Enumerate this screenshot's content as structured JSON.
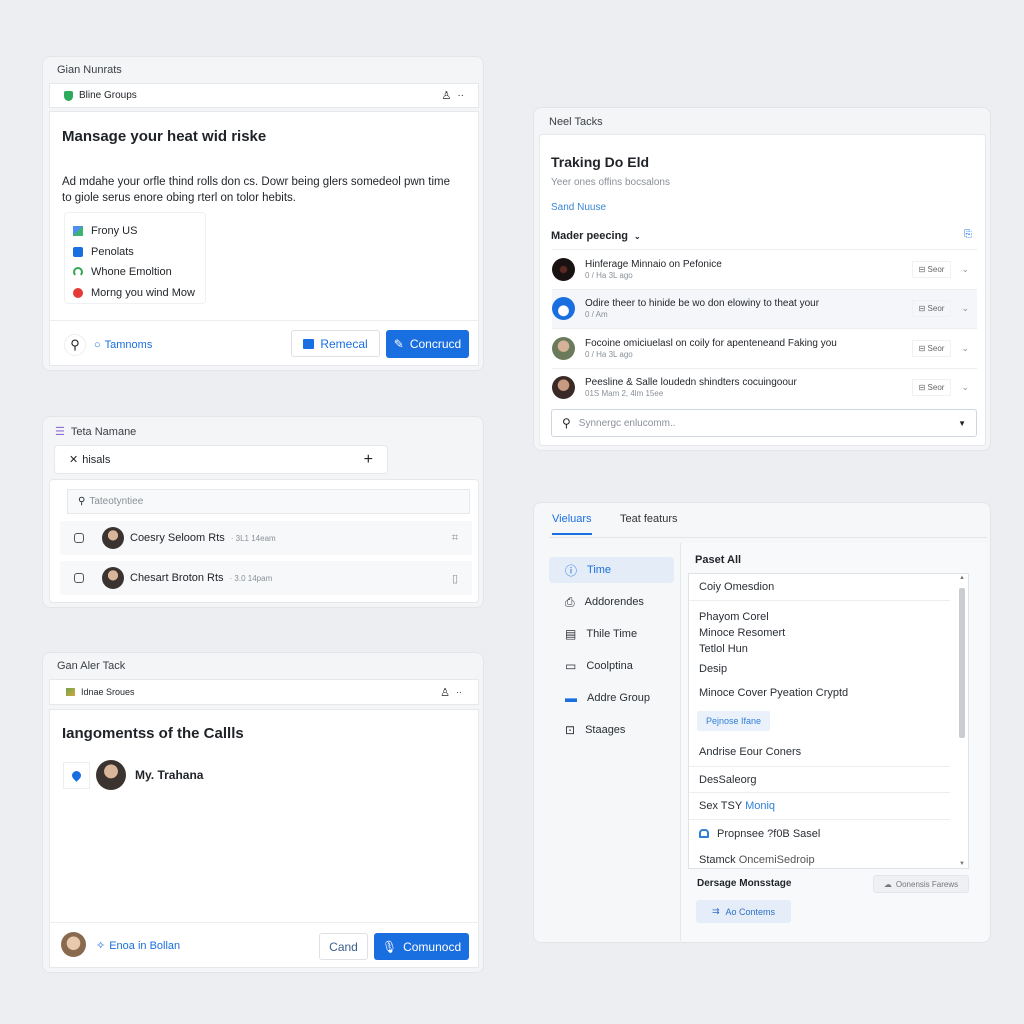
{
  "panel1": {
    "title": "Gian Nunrats",
    "header": "Bline Groups",
    "heading": "Mansage your heat wid riske",
    "body": "Ad mdahe your orfle thind rolls don cs. Dowr being glers somedeol pwn time to giole serus enore obing rterl on tolor hebits.",
    "items": [
      {
        "label": "Frony US",
        "icon": "apps-icon",
        "color": "#3b82f6"
      },
      {
        "label": "Penolats",
        "icon": "document-icon",
        "color": "#1a6fe0"
      },
      {
        "label": "Whone Emoltion",
        "icon": "refresh-icon",
        "color": "#34a853"
      },
      {
        "label": "Morng you wind Mow",
        "icon": "record-icon",
        "color": "#e53935"
      }
    ],
    "link": "Tamnoms",
    "secondary": "Remecal",
    "primary": "Concrucd"
  },
  "panel2": {
    "title": "Neel Tacks",
    "heading": "Traking Do Eld",
    "subtitle": "Yeer ones offins bocsalons",
    "link": "Sand Nuuse",
    "section": "Mader peecing",
    "rows": [
      {
        "title": "Hinferage Minnaio on Pefonice",
        "meta": "0 / Ha 3L ago",
        "action": "Seor"
      },
      {
        "title": "Odire theer to hinide be wo don elowiny to theat your",
        "meta": "0 / Am",
        "action": "Seor"
      },
      {
        "title": "Focoine omiciuelasl on coily for apenteneand Faking you",
        "meta": "0 / Ha 3L ago",
        "action": "Seor"
      },
      {
        "title": "Peesline & Salle loudedn shindters cocuingoour",
        "meta": "01S Mam 2, 4lm 15ee",
        "action": "Seor"
      }
    ],
    "search_placeholder": "Synnergc enlucomm.."
  },
  "panel3": {
    "title": "Teta Namane",
    "tab": "hisals",
    "search_placeholder": "Tateotyntiee",
    "rows": [
      {
        "name": "Coesry Seloom Rts",
        "meta": "· 3L1 14eam"
      },
      {
        "name": "Chesart Broton Rts",
        "meta": "· 3.0 14pam"
      }
    ]
  },
  "panel4": {
    "title": "Gan Aler Tack",
    "header": "Idnae Sroues",
    "heading": "Iangomentss of the Callls",
    "person": "My. Trahana",
    "link": "Enoa in Bollan",
    "secondary": "Cand",
    "primary": "Comunocd"
  },
  "panel5": {
    "tabs": [
      "Vieluars",
      "Teat featurs"
    ],
    "active_tab": 0,
    "sidebar": [
      {
        "label": "Time",
        "icon": "clock-icon"
      },
      {
        "label": "Addorendes",
        "icon": "clipboard-icon"
      },
      {
        "label": "Thile Time",
        "icon": "checklist-icon"
      },
      {
        "label": "Coolptina",
        "icon": "document-icon"
      },
      {
        "label": "Addre Group",
        "icon": "group-icon"
      },
      {
        "label": "Staages",
        "icon": "stages-icon"
      }
    ],
    "pane_title": "Paset All",
    "list": {
      "item0": "Coiy Omesdion",
      "group": [
        "Phayom Corel",
        "Minoce Resomert",
        "Tetlol Hun"
      ],
      "item1": "Desip",
      "item2": "Minoce Cover Pyeation Cryptd",
      "chip": "Pejnose Ifane",
      "item3": "Andrise Eour Coners",
      "item4": "DesSaleorg",
      "item5a": "Sex TSY",
      "item5b": "Moniq",
      "item6": "Propnsee ?f0B Sasel",
      "item7a": "Stamck",
      "item7b": "OncemiSedroip"
    },
    "footer_label": "Dersage Monsstage",
    "footer_button": "Oonensis Farews",
    "add_button": "Ao Contems"
  },
  "colors": {
    "accent": "#1a6fe0",
    "background": "#eceef2"
  }
}
